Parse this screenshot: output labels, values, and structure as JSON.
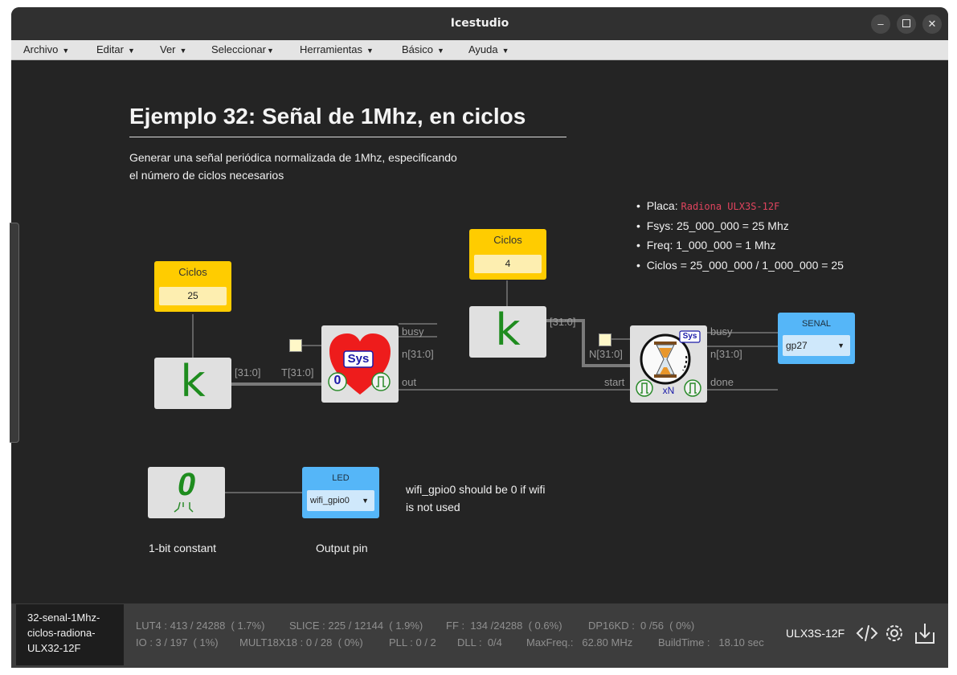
{
  "window": {
    "title": "Icestudio"
  },
  "menu": [
    {
      "label": "Archivo"
    },
    {
      "label": "Editar"
    },
    {
      "label": "Ver"
    },
    {
      "label": "Seleccionar"
    },
    {
      "label": "Herramientas"
    },
    {
      "label": "Básico"
    },
    {
      "label": "Ayuda"
    }
  ],
  "doc": {
    "heading": "Ejemplo 32: Señal de 1Mhz, en ciclos",
    "desc_line1": "Generar una señal periódica normalizada de 1Mhz, especificando",
    "desc_line2": "el número de ciclos necesarios",
    "notes": {
      "placa_label": "Placa:",
      "placa_value": "Radiona ULX3S-12F",
      "fsys": "Fsys: 25_000_000 = 25 Mhz",
      "freq": "Freq: 1_000_000 = 1 Mhz",
      "ciclos": "Ciclos = 25_000_000 / 1_000_000 = 25"
    },
    "wifi_note_line1": "wifi_gpio0 should be 0 if wifi",
    "wifi_note_line2": "is not used"
  },
  "blocks": {
    "const1": {
      "label": "Ciclos",
      "value": "25"
    },
    "const2": {
      "label": "Ciclos",
      "value": "4"
    },
    "k_glyph": "k",
    "gen": {
      "sys": "Sys",
      "zero": "0",
      "ports": {
        "busy": "busy",
        "n": "n[31:0]",
        "out": "out",
        "T": "T[31:0]",
        "in": "[31:0]"
      }
    },
    "timer": {
      "sys": "Sys",
      "xn": "xN",
      "ports": {
        "busy": "busy",
        "n": "n[31:0]",
        "done": "done",
        "N": "N[31:0]",
        "start": "start",
        "in": "[31:0]"
      }
    },
    "senal": {
      "label": "SENAL",
      "pin": "gp27"
    },
    "led": {
      "label": "LED",
      "pin": "wifi_gpio0"
    },
    "bit": {
      "glyph": "0",
      "caption": "1-bit constant"
    },
    "led_caption": "Output pin"
  },
  "status": {
    "project_line1": "32-senal-1Mhz-",
    "project_line2": "ciclos-radiona-",
    "project_line3": "ULX32-12F",
    "lut4": "LUT4 : 413 / 24288  ( 1.7%)",
    "slice": "SLICE : 225 / 12144  ( 1.9%)",
    "ff": "FF :  134 /24288  ( 0.6%)",
    "dp16kd": "DP16KD :  0 /56  ( 0%)",
    "io": "IO : 3 / 197  ( 1%)",
    "mult": "MULT18X18 : 0 / 28  ( 0%)",
    "pll": "PLL : 0 / 2",
    "dll": "DLL :  0/4",
    "maxfreq": "MaxFreq.:   62.80 MHz",
    "buildtime": "BuildTime :   18.10 sec",
    "board": "ULX3S-12F"
  },
  "colors": {
    "canvas": "#242424",
    "constant_block": "#ffcc00",
    "io_block": "#55b6f8",
    "k_green": "#1e8c1e",
    "wire": "#777777"
  },
  "icons": [
    "minimize-icon",
    "maximize-icon",
    "close-icon",
    "code-icon",
    "settings-gear-icon",
    "upload-icon",
    "heart-icon",
    "hourglass-icon",
    "pulse-icon"
  ]
}
